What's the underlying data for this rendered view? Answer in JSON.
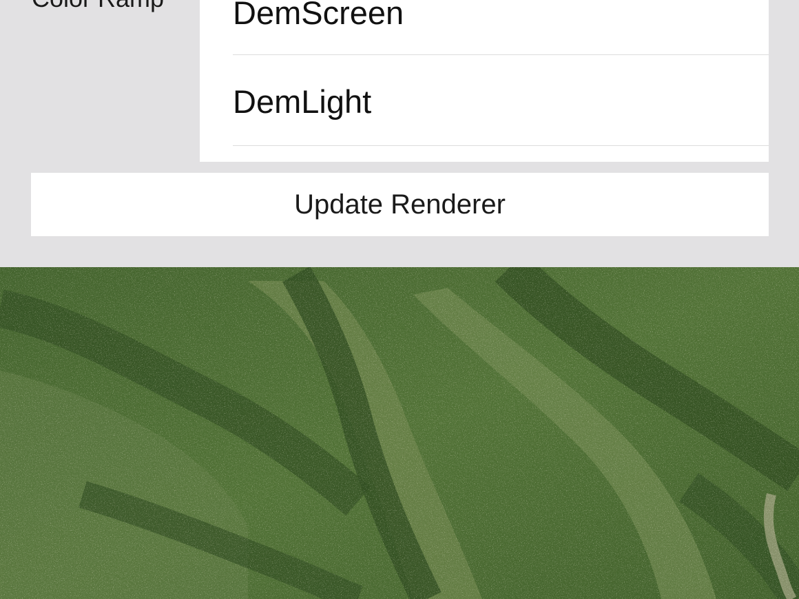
{
  "settings": {
    "color_ramp_label": "Color Ramp",
    "color_ramp_options": [
      "DemScreen",
      "DemLight"
    ],
    "update_button_label": "Update Renderer"
  },
  "map": {
    "layer": "satellite imagery",
    "colors": {
      "forest_dark": "#2c4a1f",
      "forest_mid": "#4b6b33",
      "forest_light": "#7a8f56",
      "bare_ground": "#b7ae93"
    }
  },
  "colors": {
    "panel_background": "#e2e1e3",
    "control_background": "#ffffff",
    "separator": "#dcdcdc",
    "text": "#111111"
  }
}
